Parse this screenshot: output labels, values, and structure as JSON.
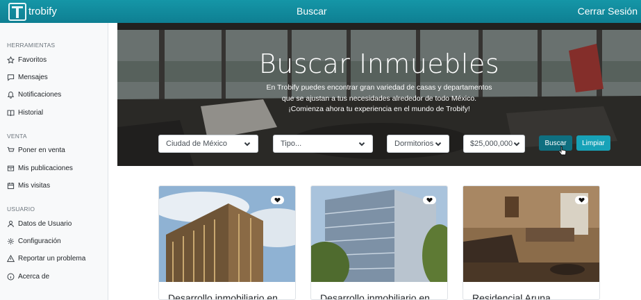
{
  "topbar": {
    "brand": "trobify",
    "search_link": "Buscar",
    "logout_link": "Cerrar Sesión"
  },
  "sidebar": {
    "sections": [
      {
        "heading": "HERRAMIENTAS",
        "items": [
          {
            "label": "Favoritos",
            "icon": "star-icon"
          },
          {
            "label": "Mensajes",
            "icon": "message-icon"
          },
          {
            "label": "Notificaciones",
            "icon": "bell-icon"
          },
          {
            "label": "Historial",
            "icon": "book-icon"
          }
        ]
      },
      {
        "heading": "VENTA",
        "items": [
          {
            "label": "Poner en venta",
            "icon": "cart-icon"
          },
          {
            "label": "Mis publicaciones",
            "icon": "inbox-icon"
          },
          {
            "label": "Mis visitas",
            "icon": "calendar-icon"
          }
        ]
      },
      {
        "heading": "USUARIO",
        "items": [
          {
            "label": "Datos de Usuario",
            "icon": "person-icon"
          },
          {
            "label": "Configuración",
            "icon": "gear-icon"
          },
          {
            "label": "Reportar un problema",
            "icon": "warning-icon"
          },
          {
            "label": "Acerca de",
            "icon": "info-icon"
          }
        ]
      }
    ]
  },
  "hero": {
    "title": "Buscar Inmuebles",
    "description_lines": [
      "En Trobify puedes encontrar gran variedad de casas y departamentos",
      "que se ajustan a tus necesidades alrededor de todo México.",
      "¡Comienza ahora tu experiencia en el mundo de Trobify!"
    ]
  },
  "filters": {
    "city": "Ciudad de México",
    "type": "Tipo...",
    "bedrooms": "Dormitorios",
    "price": "$25,000,000",
    "search_button": "Buscar",
    "clear_button": "Limpiar"
  },
  "cards": [
    {
      "title": "Desarrollo inmobiliario en"
    },
    {
      "title": "Desarrollo inmobiliario en"
    },
    {
      "title": "Residencial Aruna"
    }
  ],
  "colors": {
    "topbar": "#1596a7",
    "search_button": "#0f6f80",
    "clear_button": "#17a2b8"
  }
}
